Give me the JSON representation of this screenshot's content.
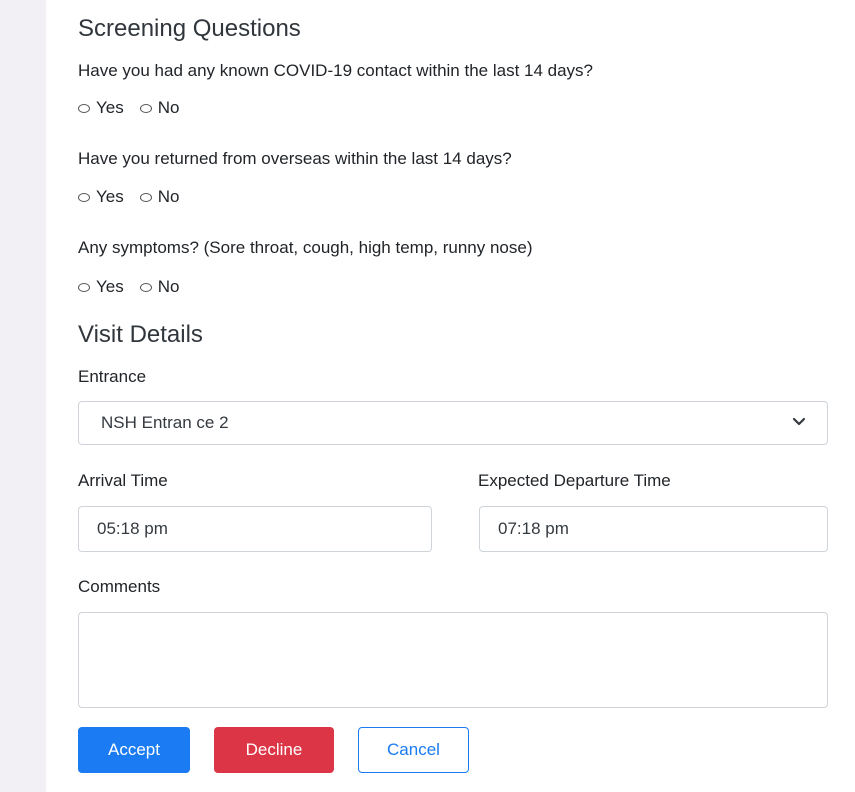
{
  "screening": {
    "title": "Screening Questions",
    "questions": [
      {
        "text": "Have you had any known COVID-19 contact within the last 14 days?",
        "yes": "Yes",
        "no": "No"
      },
      {
        "text": "Have you returned from overseas within the last 14 days?",
        "yes": "Yes",
        "no": "No"
      },
      {
        "text": "Any symptoms? (Sore throat, cough, high temp, runny nose)",
        "yes": "Yes",
        "no": "No"
      }
    ]
  },
  "visit": {
    "title": "Visit Details",
    "entrance_label": "Entrance",
    "entrance_value": "NSH Entran ce 2",
    "arrival_label": "Arrival Time",
    "arrival_value": "05:18 pm",
    "departure_label": "Expected Departure Time",
    "departure_value": "07:18 pm",
    "comments_label": "Comments",
    "comments_value": ""
  },
  "actions": {
    "accept": "Accept",
    "decline": "Decline",
    "cancel": "Cancel"
  },
  "colors": {
    "primary": "#1a7bf2",
    "danger": "#dc3545",
    "side_strip": "#f2f0f4"
  },
  "icons": {
    "dropdown": "chevron-down-icon"
  }
}
